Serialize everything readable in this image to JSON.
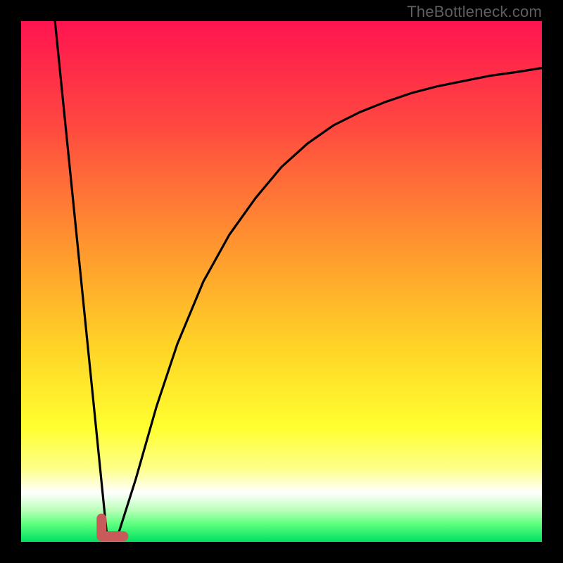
{
  "watermark": "TheBottleneck.com",
  "gradient": {
    "stops": [
      {
        "offset": 0.0,
        "color": "#ff1450"
      },
      {
        "offset": 0.2,
        "color": "#ff4840"
      },
      {
        "offset": 0.42,
        "color": "#ff9230"
      },
      {
        "offset": 0.62,
        "color": "#ffd226"
      },
      {
        "offset": 0.78,
        "color": "#ffff30"
      },
      {
        "offset": 0.86,
        "color": "#feff8a"
      },
      {
        "offset": 0.905,
        "color": "#ffffff"
      },
      {
        "offset": 0.94,
        "color": "#b8ffb8"
      },
      {
        "offset": 0.965,
        "color": "#60ff80"
      },
      {
        "offset": 1.0,
        "color": "#00e060"
      }
    ]
  },
  "marker": {
    "x_frac": 0.165,
    "width_frac": 0.042,
    "height_frac": 0.034,
    "color": "#c85a5a"
  },
  "chart_data": {
    "type": "line",
    "title": "",
    "xlabel": "",
    "ylabel": "",
    "xlim": [
      0,
      1
    ],
    "ylim": [
      0,
      1
    ],
    "x_note": "x is horizontal fraction of plot width (0=left,1=right)",
    "y_note": "y is value height fraction (0=bottom,1=top)",
    "series": [
      {
        "name": "left-descending-line",
        "x": [
          0.065,
          0.165
        ],
        "y": [
          1.0,
          0.01
        ]
      },
      {
        "name": "right-rising-curve",
        "x": [
          0.185,
          0.22,
          0.26,
          0.3,
          0.35,
          0.4,
          0.45,
          0.5,
          0.55,
          0.6,
          0.65,
          0.7,
          0.75,
          0.8,
          0.85,
          0.9,
          0.95,
          1.0
        ],
        "y": [
          0.01,
          0.12,
          0.26,
          0.38,
          0.5,
          0.59,
          0.66,
          0.72,
          0.765,
          0.8,
          0.825,
          0.845,
          0.862,
          0.875,
          0.885,
          0.895,
          0.902,
          0.91
        ]
      }
    ],
    "annotations": [
      {
        "label": "optimum-marker",
        "x": 0.175,
        "y": 0.017
      }
    ]
  }
}
